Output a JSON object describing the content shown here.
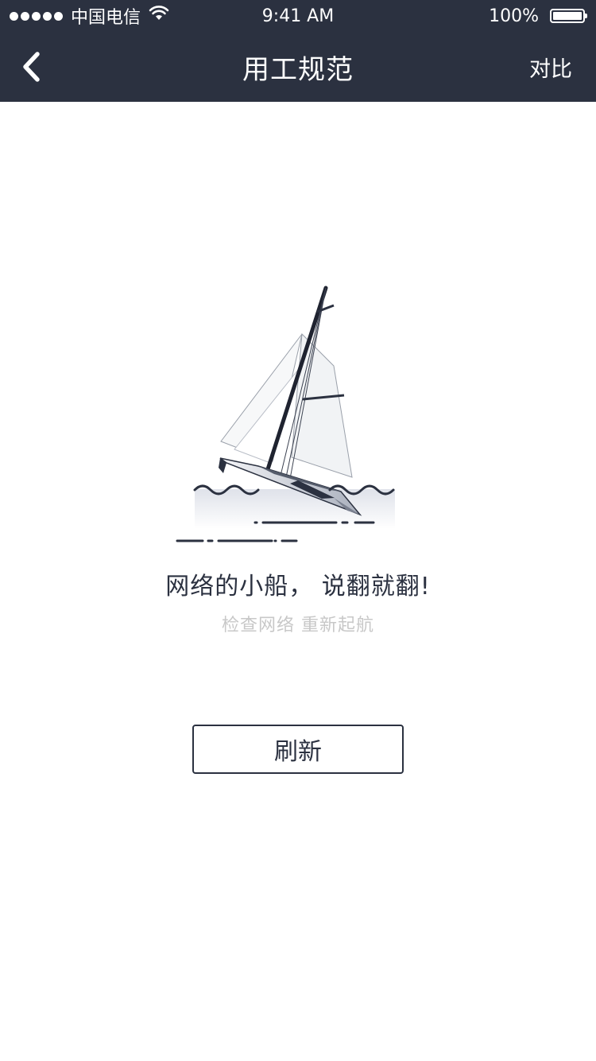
{
  "status_bar": {
    "carrier": "中国电信",
    "time": "9:41 AM",
    "battery": "100%"
  },
  "nav": {
    "back_icon": "chevron-left-icon",
    "title": "用工规范",
    "action_label": "对比"
  },
  "empty_state": {
    "illustration": "sailboat-capsized-illustration",
    "headline": "网络的小船， 说翻就翻!",
    "subline": "检查网络 重新起航",
    "refresh_label": "刷新"
  },
  "colors": {
    "nav_background": "#2b3140",
    "text_dark": "#2b3140",
    "text_muted": "#c8c8c8"
  }
}
